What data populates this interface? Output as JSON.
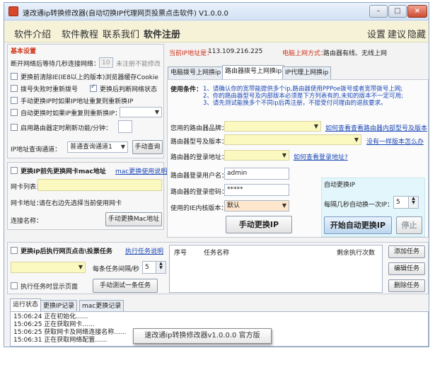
{
  "window": {
    "title": "速改通ip转换修改器(自动切换IP代理网页投票点击软件) V1.0.0.0",
    "controls": [
      "–",
      "□",
      "×"
    ]
  },
  "menu": {
    "items": [
      "软件介绍",
      "软件教程",
      "联系我们",
      "软件注册"
    ],
    "right": [
      "设置",
      "建议",
      "隐藏"
    ]
  },
  "basic": {
    "title": "基本设置",
    "wait_label": "断开网络后等待几秒连接网络：",
    "wait_value": "10",
    "wait_hint": "未注册不能修改",
    "opt_clear_cookie": "更换前清除IE(IE8以上的版本)浏览器缓存Cookie",
    "opt_redial": "拨号失败时重新拨号",
    "opt_check_net": "更换后判断网络状态",
    "opt_manual_dup": "手动更换IP时如果IP地址重复则重新换IP",
    "opt_auto_dup": "自动更换时如果IP重复则重新换IP：",
    "opt_router_timer": "启用路由器定时刷新功能/分钟：",
    "channel_label": "IP地址查询通道：",
    "channel_value": "普通查询通道1",
    "query_button": "手动查询"
  },
  "status": {
    "ip_label": "当前IP地址是：",
    "ip_value": "113.109.216.225",
    "mode_label": "电脑上网方式：",
    "mode_value": "路由器有线、无线上网"
  },
  "tabs": [
    "电脑拨号上网换ip",
    "路由器拨号上网换ip",
    "IP代理上网换ip"
  ],
  "router": {
    "usage_label": "使用条件：",
    "usage_lines": [
      "1、请确认你的宽带能提供多个ip,路由器使用PPPoe拨号或者宽带拨号上网;",
      "2、你的路由器型号及内部版本必须是下方列表有的,未知的版本不一定可用;",
      "3、请先测试能换多个不同ip后再注册，不接受付问理由的退款要求。"
    ],
    "brand_label": "您用的路由器品牌：",
    "brand_link": "如何查看查看路由器内部型号及版本",
    "model_label": "路由器型号及版本：",
    "model_link": "没有一样版本怎么办",
    "login_label": "路由器的登录地址：",
    "login_link": "如何查看登录地址?",
    "user_label": "路由器登录用户名：",
    "user_value": "admin",
    "pass_label": "路由器的登录密码：",
    "pass_value": "*****",
    "core_label": "使用的IE内核版本：",
    "core_value": "默认",
    "manual_button": "手动更换IP",
    "auto_title": "自动更换IP",
    "interval_label": "每隔几秒自动换一次IP：",
    "interval_value": "5",
    "auto_start_button": "开始自动更换IP",
    "stop_button": "停止"
  },
  "mac": {
    "title": "更换IP前先更换网卡mac地址",
    "help_link": "mac更换使用说明",
    "card_label": "网卡列表：",
    "addr_label": "网卡地址：",
    "addr_value": "请在右边先选择当前使用网卡",
    "conn_label": "连接名称：",
    "change_button": "手动更换Mac地址"
  },
  "tasks": {
    "title": "更换ip后执行网页点击\\投票任务",
    "help_link": "执行任务说明",
    "interval_label": "每条任务间隔/秒",
    "interval_value": "5",
    "show_page": "执行任务时显示页面",
    "test_button": "手动测试一条任务",
    "columns": [
      "序号",
      "任务名称",
      "剩余执行次数"
    ],
    "add": "添加任务",
    "edit": "编辑任务",
    "delete": "删除任务"
  },
  "log": {
    "tabs": [
      "运行状态",
      "更换IP记录",
      "mac更换记录"
    ],
    "lines": [
      "15:06:24  正在初始化......",
      "15:06:25  正在获取网卡......",
      "15:06:25  获取网卡及网络连接名称......",
      "15:06:31  正在获取网络配置......"
    ]
  },
  "tooltip": "速改通ip转换修改器v1.0.0.0 官方版"
}
